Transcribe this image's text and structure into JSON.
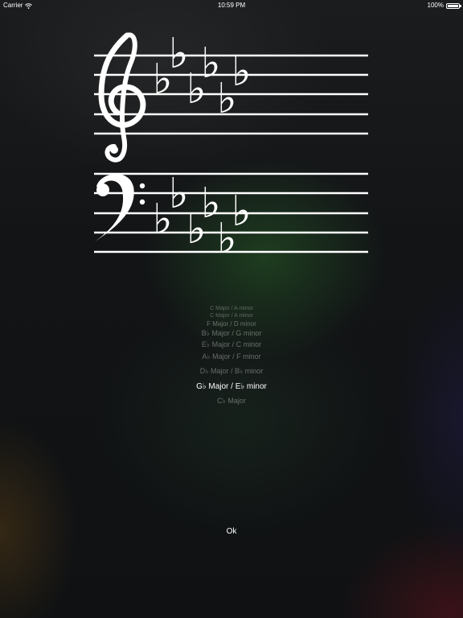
{
  "status_bar": {
    "carrier": "Carrier",
    "time": "10:59 PM",
    "battery": "100%",
    "battery_level": 1.0
  },
  "key_signature": {
    "accidental_symbol": "♭",
    "treble_flat_count": 6,
    "bass_flat_count": 6
  },
  "picker": {
    "items": [
      {
        "label": "C Major / A minor"
      },
      {
        "label": "C Major / A minor"
      },
      {
        "label": "F Major / D minor"
      },
      {
        "label": "B♭ Major / G minor"
      },
      {
        "label": "E♭ Major / C minor"
      },
      {
        "label": "A♭ Major / F minor"
      },
      {
        "label": "D♭ Major / B♭ minor"
      },
      {
        "label": "G♭ Major / E♭ minor"
      },
      {
        "label": "C♭ Major"
      }
    ],
    "selected_index": 7
  },
  "ok_button": {
    "label": "Ok"
  }
}
